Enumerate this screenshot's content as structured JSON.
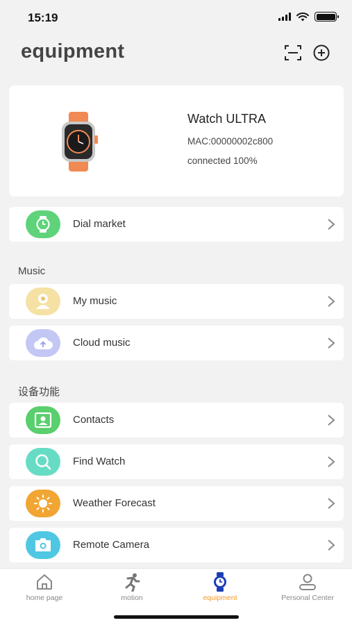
{
  "status_bar": {
    "time": "15:19",
    "icons": [
      "signal-icon",
      "wifi-icon",
      "battery-icon"
    ]
  },
  "header": {
    "title": "equipment",
    "scan_icon": "scan-icon",
    "add_icon": "add-circle-icon"
  },
  "device": {
    "name": "Watch ULTRA",
    "mac": "MAC:00000002c800",
    "status": "connected 100%",
    "image_icon": "smartwatch-image"
  },
  "dial_market": {
    "label": "Dial market",
    "icon": "watch-face-icon",
    "color": "#5fd37a"
  },
  "music_section": {
    "title": "Music",
    "items": [
      {
        "label": "My music",
        "icon": "music-note-icon",
        "color": "#f5e1a4"
      },
      {
        "label": "Cloud music",
        "icon": "cloud-upload-icon",
        "color": "#c3c7f4"
      }
    ]
  },
  "device_section": {
    "title": "设备功能",
    "items": [
      {
        "label": "Contacts",
        "icon": "contacts-icon",
        "color": "#59cf6d"
      },
      {
        "label": "Find Watch",
        "icon": "search-watch-icon",
        "color": "#67dcc5"
      },
      {
        "label": "Weather Forecast",
        "icon": "sun-icon",
        "color": "#f1a533"
      },
      {
        "label": "Remote Camera",
        "icon": "camera-icon",
        "color": "#4fc7e3"
      }
    ]
  },
  "tab_bar": {
    "tabs": [
      {
        "label": "home page",
        "icon": "home-icon"
      },
      {
        "label": "motion",
        "icon": "runner-icon"
      },
      {
        "label": "equipment",
        "icon": "watch-icon",
        "active": true
      },
      {
        "label": "Personal Center",
        "icon": "person-icon"
      }
    ],
    "active_color": "#f59a23"
  }
}
